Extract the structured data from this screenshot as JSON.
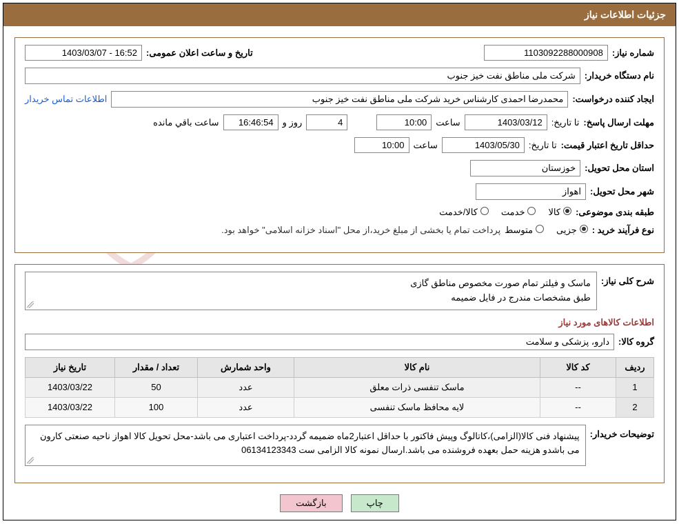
{
  "title_bar": "جزئیات اطلاعات نیاز",
  "section1": {
    "need_number_label": "شماره نیاز:",
    "need_number": "1103092288000908",
    "announce_label": "تاریخ و ساعت اعلان عمومی:",
    "announce_value": "16:52 - 1403/03/07",
    "buyer_org_label": "نام دستگاه خریدار:",
    "buyer_org": "شرکت ملی مناطق نفت خیز جنوب",
    "requester_label": "ایجاد کننده درخواست:",
    "requester": "محمدرضا احمدی  کارشناس خرید  شرکت ملی مناطق نفت خیز جنوب",
    "contact_link": "اطلاعات تماس خریدار",
    "deadline_label": "مهلت ارسال پاسخ:",
    "upto_label": "تا تاریخ:",
    "deadline_date": "1403/03/12",
    "hour_label": "ساعت",
    "deadline_hour": "10:00",
    "days_value": "4",
    "days_and": "روز و",
    "countdown": "16:46:54",
    "remaining": "ساعت باقي مانده",
    "min_valid_label": "حداقل تاریخ اعتبار قیمت:",
    "min_valid_date": "1403/05/30",
    "min_valid_hour": "10:00",
    "province_label": "استان محل تحویل:",
    "province": "خوزستان",
    "city_label": "شهر محل تحویل:",
    "city": "اهواز",
    "subject_class_label": "طبقه بندی موضوعی:",
    "subject_kala": "کالا",
    "subject_service": "خدمت",
    "subject_both": "کالا/خدمت",
    "proc_type_label": "نوع فرآیند خرید :",
    "proc_partial": "جزیی",
    "proc_medium": "متوسط",
    "payment_note": "پرداخت تمام یا بخشی از مبلغ خرید،از محل \"اسناد خزانه اسلامی\" خواهد بود."
  },
  "section2": {
    "general_desc_label": "شرح کلی نیاز:",
    "general_desc_line1": "ماسک و فیلتر تمام صورت مخصوص مناطق گازی",
    "general_desc_line2": "طبق مشخصات مندرج در فایل ضمیمه",
    "items_heading": "اطلاعات کالاهای مورد نیاز",
    "group_label": "گروه کالا:",
    "group_value": "دارو، پزشکی و سلامت",
    "table": {
      "headers": {
        "row": "ردیف",
        "code": "کد کالا",
        "name": "نام کالا",
        "unit": "واحد شمارش",
        "qty": "تعداد / مقدار",
        "need_date": "تاریخ نیاز"
      },
      "rows": [
        {
          "idx": "1",
          "code": "--",
          "name": "ماسک تنفسی ذرات معلق",
          "unit": "عدد",
          "qty": "50",
          "need_date": "1403/03/22"
        },
        {
          "idx": "2",
          "code": "--",
          "name": "لایه محافظ ماسک تنفسی",
          "unit": "عدد",
          "qty": "100",
          "need_date": "1403/03/22"
        }
      ]
    },
    "buyer_notes_label": "توضیحات خریدار:",
    "buyer_notes": "پیشنهاد فنی کالا(الزامی)،کاتالوگ وپیش فاکتور با حداقل اعتبار2ماه ضمیمه گردد-پرداخت اعتباری می باشد-محل تحویل کالا اهواز ناحیه صنعتی کارون می باشدو هزینه حمل بعهده فروشنده می باشد.ارسال نمونه کالا الزامی ست 06134123343"
  },
  "buttons": {
    "print": "چاپ",
    "back": "بازگشت"
  }
}
